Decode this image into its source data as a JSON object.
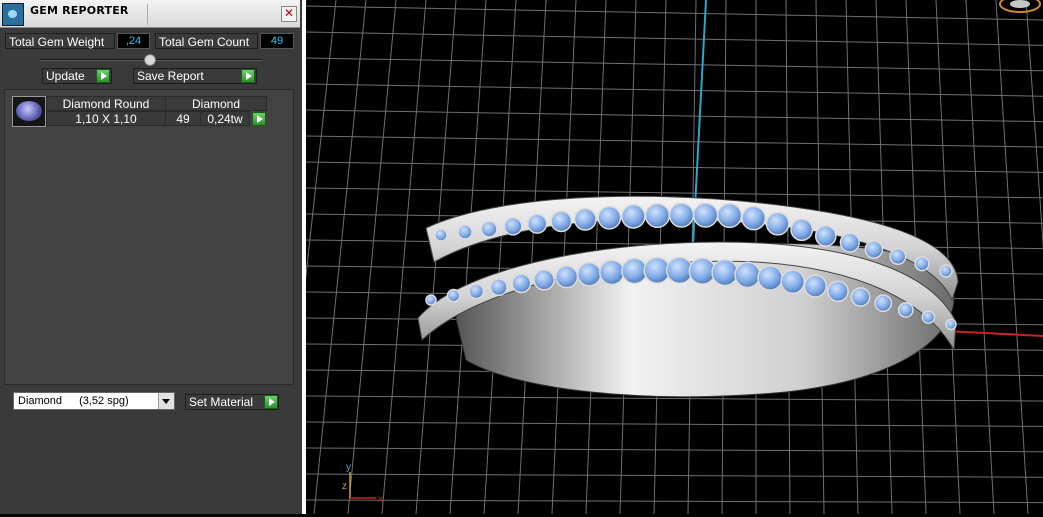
{
  "window": {
    "title": "GEM REPORTER",
    "close_glyph": "✕"
  },
  "summary": {
    "total_weight_label": "Total Gem Weight",
    "total_weight_value": ",24",
    "total_count_label": "Total Gem Count",
    "total_count_value": "49"
  },
  "buttons": {
    "update_label": "Update",
    "save_report_label": "Save Report",
    "set_material_label": "Set Material"
  },
  "gem_list": {
    "headers": [
      "Diamond Round",
      "Diamond"
    ],
    "rows": [
      {
        "size": "1,10 X 1,10",
        "count": "49",
        "weight": "0,24tw",
        "icon": "round-gem-icon"
      }
    ]
  },
  "material": {
    "selected_name": "Diamond",
    "selected_spg": "(3,52 spg)"
  },
  "viewport": {
    "axis_labels": {
      "y": "y",
      "z": "z",
      "x": "x"
    },
    "colors": {
      "grid": "#777777",
      "x_axis": "#cc2222",
      "y_axis": "#2aa7c9",
      "gem": "#7fa9e6",
      "metal": "#d8d8d8"
    }
  }
}
